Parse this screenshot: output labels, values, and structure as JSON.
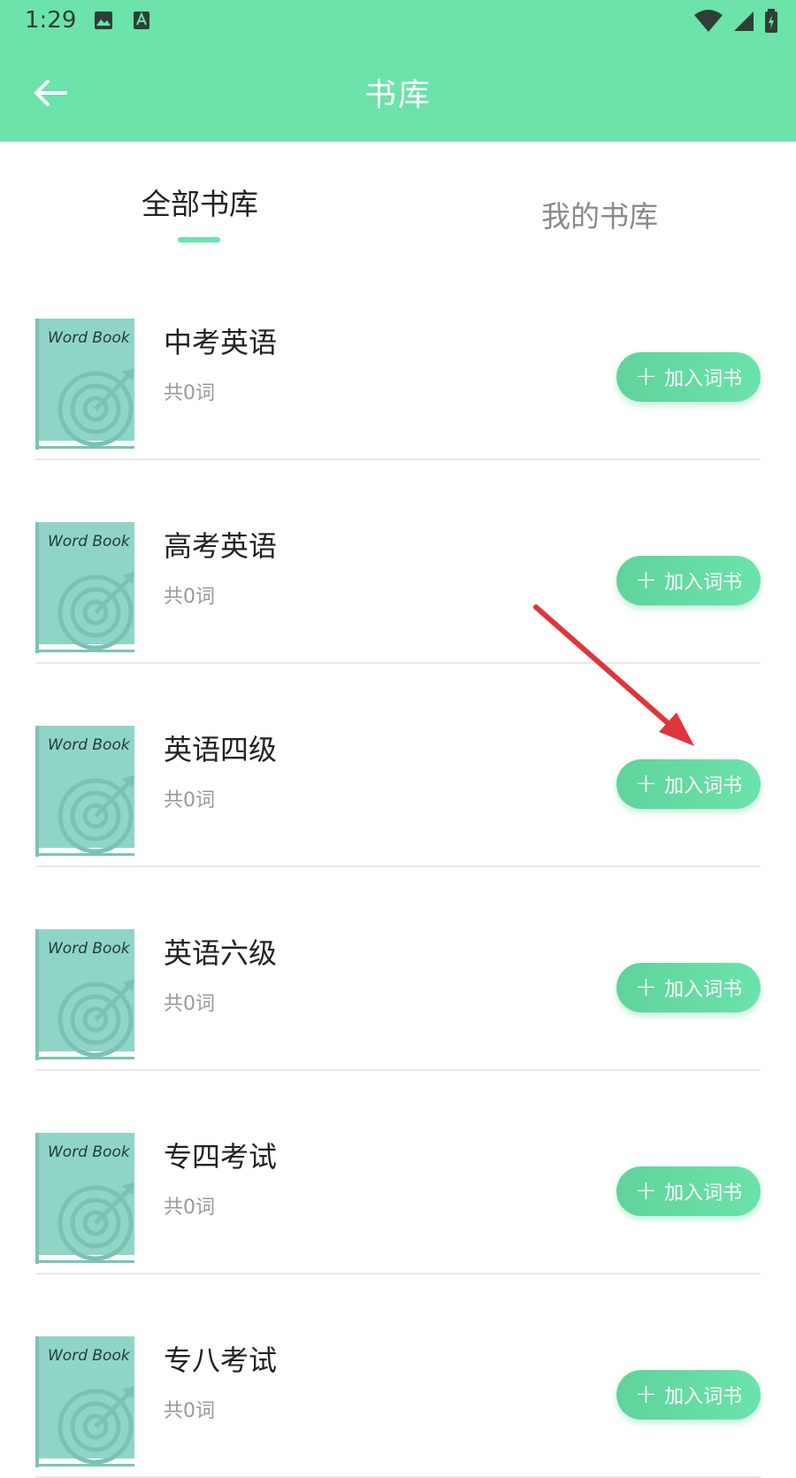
{
  "status_bar": {
    "time": "1:29"
  },
  "app_bar": {
    "title": "书库"
  },
  "tabs": [
    {
      "label": "全部书库",
      "selected": true
    },
    {
      "label": "我的书库",
      "selected": false
    }
  ],
  "books": [
    {
      "cover_label": "Word Book",
      "title": "中考英语",
      "count": "共0词",
      "button": "加入词书"
    },
    {
      "cover_label": "Word Book",
      "title": "高考英语",
      "count": "共0词",
      "button": "加入词书"
    },
    {
      "cover_label": "Word Book",
      "title": "英语四级",
      "count": "共0词",
      "button": "加入词书"
    },
    {
      "cover_label": "Word Book",
      "title": "英语六级",
      "count": "共0词",
      "button": "加入词书"
    },
    {
      "cover_label": "Word Book",
      "title": "专四考试",
      "count": "共0词",
      "button": "加入词书"
    },
    {
      "cover_label": "Word Book",
      "title": "专八考试",
      "count": "共0词",
      "button": "加入词书"
    }
  ],
  "colors": {
    "accent": "#6be3ab",
    "cover": "#8fd5c7",
    "annotation_arrow": "#e0353a"
  }
}
